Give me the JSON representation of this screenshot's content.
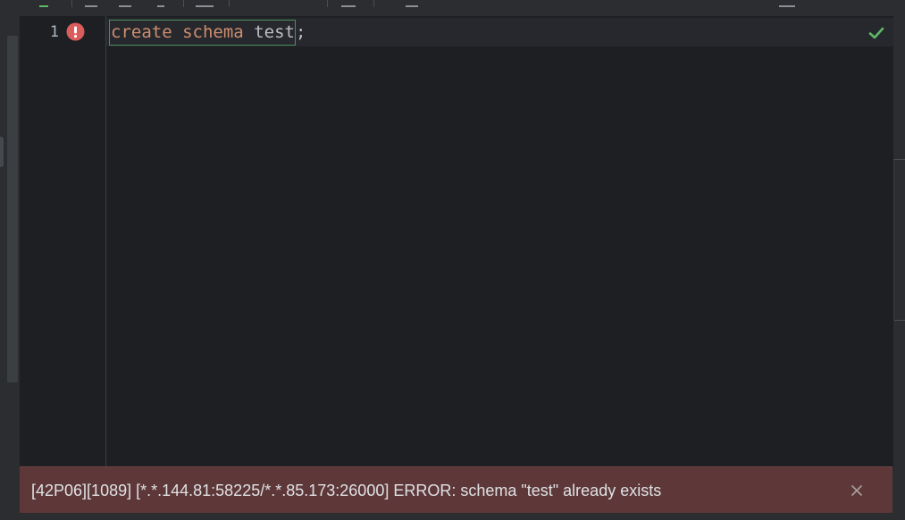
{
  "editor": {
    "line_number": "1",
    "code": {
      "keyword_create": "create",
      "keyword_schema": "schema",
      "identifier": "test",
      "terminator": ";"
    },
    "gutter_marker_icon": "error-circle-icon",
    "inspection_status_icon": "checkmark-icon"
  },
  "error_banner": {
    "message": "[42P06][1089] [*.*.144.81:58225/*.*.85.173:26000] ERROR: schema \"test\" already exists",
    "close_icon": "close-icon"
  },
  "colors": {
    "editor_background": "#1e1f22",
    "keyword": "#cf8e6d",
    "error_banner_background": "#5e3838",
    "error_marker": "#db5c5c",
    "success_check": "#5fb865"
  }
}
